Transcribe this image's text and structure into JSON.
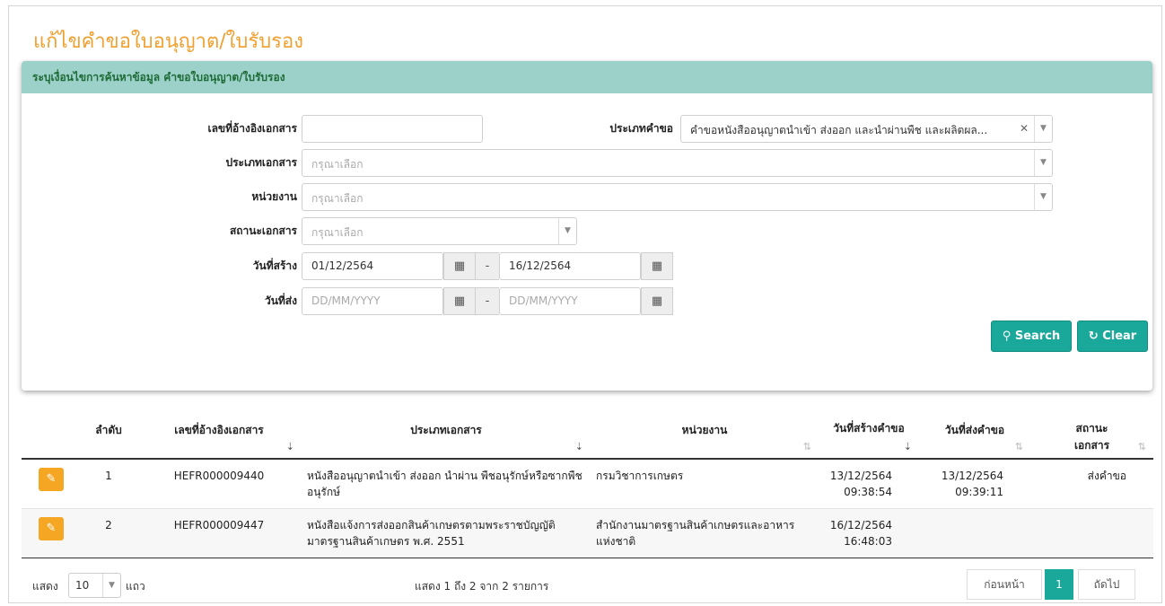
{
  "page": {
    "title": "แก้ไขคำขอใบอนุญาต/ใบรับรอง"
  },
  "search_panel": {
    "header": "ระบุเงื่อนไขการค้นหาข้อมูล คำขอใบอนุญาต/ใบรับรอง",
    "ref_no": {
      "label": "เลขที่อ้างอิงเอกสาร",
      "value": ""
    },
    "request_type": {
      "label": "ประเภทคำขอ",
      "value": "คำขอหนังสืออนุญาตนำเข้า ส่งออก และนำผ่านพืช และผลิตผล..."
    },
    "doc_type": {
      "label": "ประเภทเอกสาร",
      "placeholder": "กรุณาเลือก"
    },
    "agency": {
      "label": "หน่วยงาน",
      "placeholder": "กรุณาเลือก"
    },
    "doc_status": {
      "label": "สถานะเอกสาร",
      "placeholder": "กรุณาเลือก"
    },
    "created_date": {
      "label": "วันที่สร้าง",
      "from": "01/12/2564",
      "to": "16/12/2564"
    },
    "sent_date": {
      "label": "วันที่ส่ง",
      "from_placeholder": "DD/MM/YYYY",
      "to_placeholder": "DD/MM/YYYY"
    },
    "range_sep": "-",
    "search_label": "Search",
    "clear_label": "Clear"
  },
  "table": {
    "columns": [
      "ลำดับ",
      "เลขที่อ้างอิงเอกสาร",
      "ประเภทเอกสาร",
      "หน่วยงาน",
      "วันที่สร้างคำขอ",
      "วันที่ส่งคำขอ",
      "สถานะเอกสาร"
    ],
    "rows": [
      {
        "no": "1",
        "ref": "HEFR000009440",
        "doc_type": "หนังสืออนุญาตนำเข้า ส่งออก นำผ่าน พืชอนุรักษ์หรือซากพืชอนุรักษ์",
        "agency": "กรมวิชาการเกษตร",
        "created_date": "13/12/2564",
        "created_time": "09:38:54",
        "sent_date": "13/12/2564",
        "sent_time": "09:39:11",
        "status": "ส่งคำขอ"
      },
      {
        "no": "2",
        "ref": "HEFR000009447",
        "doc_type": "หนังสือแจ้งการส่งออกสินค้าเกษตรตามพระราชบัญญัติมาตรฐานสินค้าเกษตร พ.ศ. 2551",
        "agency": "สำนักงานมาตรฐานสินค้าเกษตรและอาหารแห่งชาติ",
        "created_date": "16/12/2564",
        "created_time": "16:48:03",
        "sent_date": "",
        "sent_time": "",
        "status": ""
      }
    ]
  },
  "footer": {
    "show_label": "แสดง",
    "page_length": "10",
    "rows_label": "แถว",
    "info": "แสดง 1 ถึง 2 จาก 2 รายการ",
    "prev_label": "ก่อนหน้า",
    "current_page": "1",
    "next_label": "ถัดไป"
  },
  "colors": {
    "title": "#f0a030",
    "panel_header": "#9bd1c9",
    "primary": "#1aa89b",
    "edit": "#f5a623"
  },
  "icons": [
    "calendar-icon",
    "search-icon",
    "refresh-icon",
    "pencil-icon",
    "sort-icon"
  ]
}
